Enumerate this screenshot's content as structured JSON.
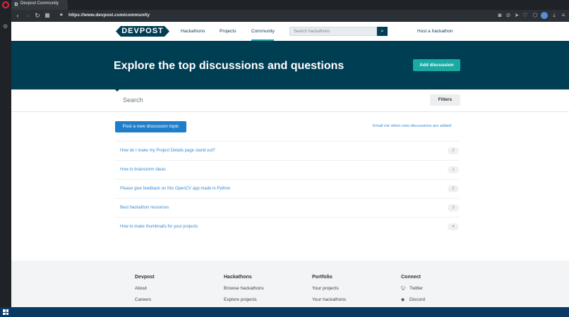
{
  "browser": {
    "tab_title": "Devpost Community",
    "tab_favicon": "D",
    "url": "https://www.devpost.com/community"
  },
  "header": {
    "logo_text": "DEVPOST",
    "nav": [
      "Hackathons",
      "Projects",
      "Community"
    ],
    "active_nav": "Community",
    "search_placeholder": "Search hackathons",
    "host_link": "Host a hackathon"
  },
  "hero": {
    "title": "Explore the top discussions and questions",
    "add_button": "Add discussion"
  },
  "search": {
    "placeholder": "Search",
    "filters_label": "Filters"
  },
  "discussions": {
    "post_button": "Post a new discussion topic",
    "email_link": "Email me when new discussions are added",
    "topics": [
      {
        "title": "How do I make my Project Details page stand out?",
        "count": "2"
      },
      {
        "title": "How to brainstorm ideas",
        "count": "1"
      },
      {
        "title": "Please give feedback on this OpenCV app made in Python",
        "count": "2"
      },
      {
        "title": "Best hackathon resources",
        "count": "3"
      },
      {
        "title": "How to make thumbnails for your projects",
        "count": "4"
      }
    ]
  },
  "footer": {
    "columns": [
      {
        "heading": "Devpost",
        "items": [
          "About",
          "Careers"
        ]
      },
      {
        "heading": "Hackathons",
        "items": [
          "Browse hackathons",
          "Explore projects"
        ]
      },
      {
        "heading": "Portfolio",
        "items": [
          "Your projects",
          "Your hackathons"
        ]
      },
      {
        "heading": "Connect",
        "items": [
          "Twitter",
          "Discord"
        ]
      }
    ]
  },
  "colors": {
    "brand_dark": "#003e54",
    "accent_teal": "#1aa9a3",
    "link_blue": "#3a8bd0",
    "button_blue": "#1f7ec9"
  }
}
